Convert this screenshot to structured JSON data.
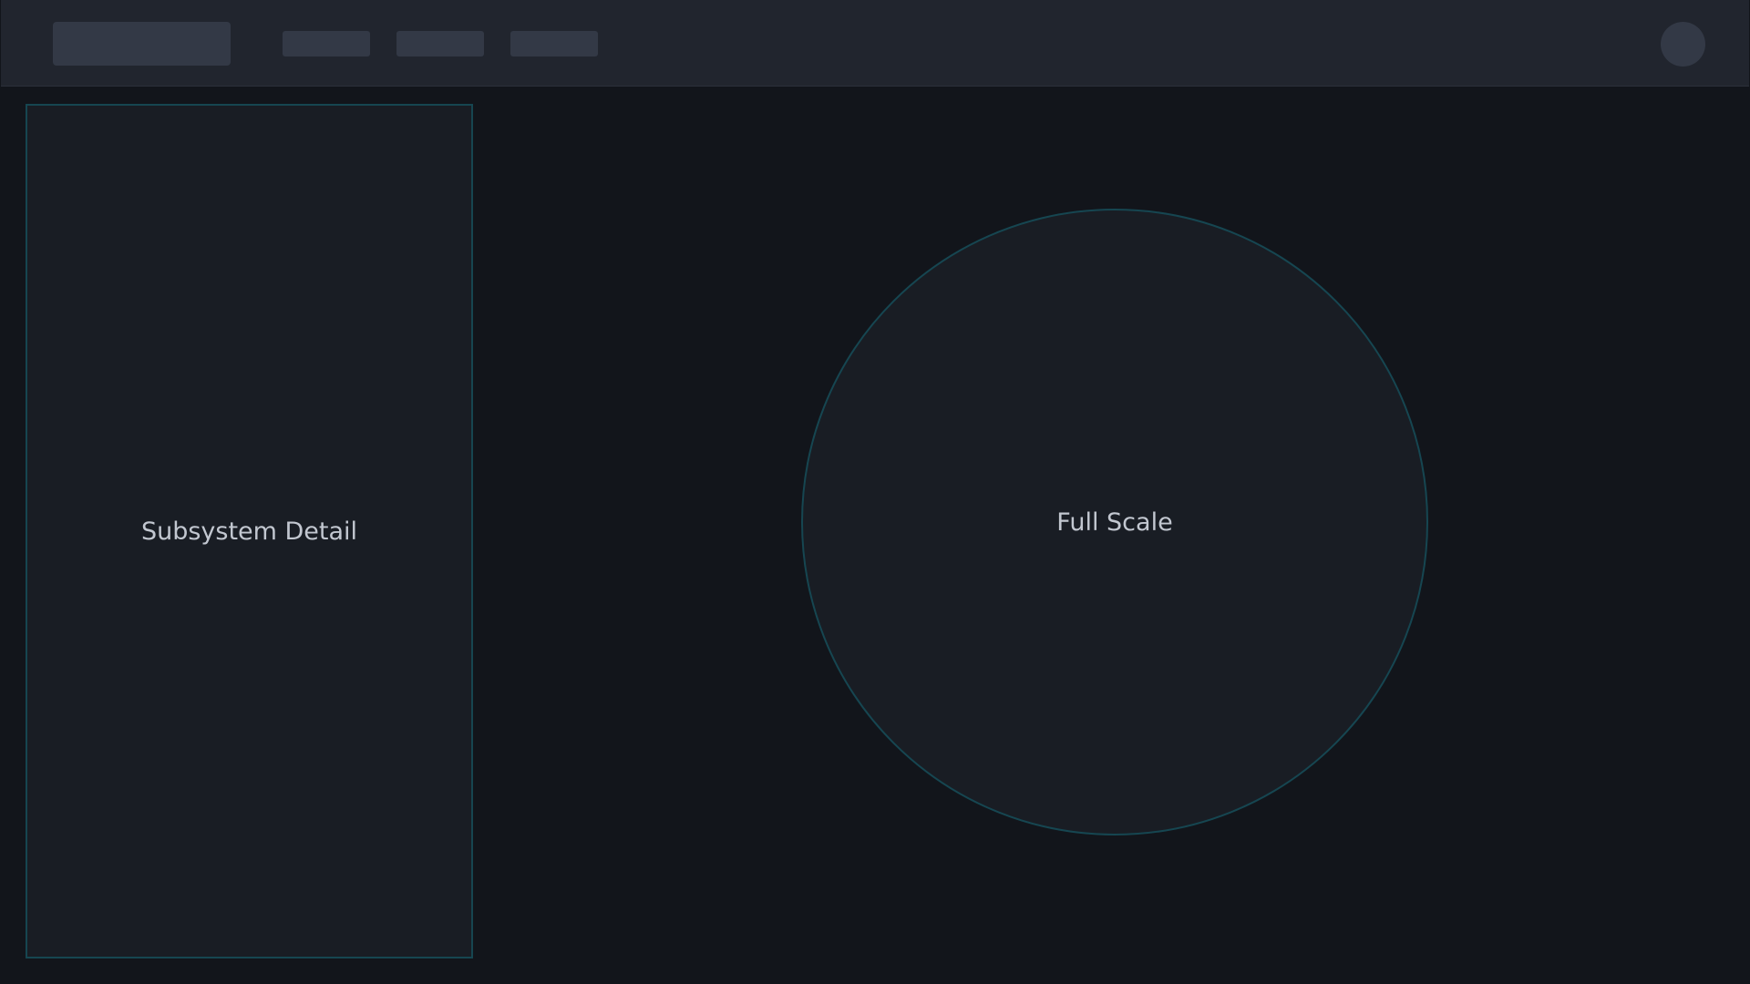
{
  "header": {
    "logo": "",
    "nav_items": [
      "",
      "",
      ""
    ],
    "avatar": ""
  },
  "main": {
    "detail_panel": {
      "label": "Subsystem Detail"
    },
    "scale_view": {
      "label": "Full Scale"
    }
  },
  "colors": {
    "background": "#12151b",
    "header": "#21252e",
    "placeholder": "#333946",
    "panel": "#191d24",
    "border_accent": "#164651",
    "text": "#c2c7d0"
  }
}
